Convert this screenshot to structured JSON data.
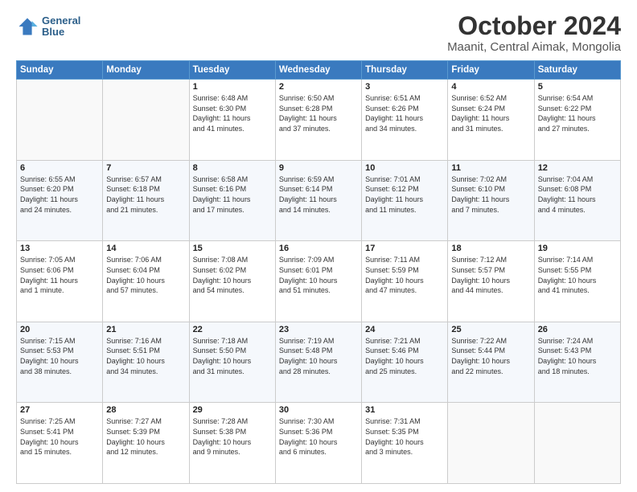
{
  "logo": {
    "line1": "General",
    "line2": "Blue"
  },
  "header": {
    "title": "October 2024",
    "subtitle": "Maanit, Central Aimak, Mongolia"
  },
  "days": [
    "Sunday",
    "Monday",
    "Tuesday",
    "Wednesday",
    "Thursday",
    "Friday",
    "Saturday"
  ],
  "weeks": [
    [
      {
        "num": "",
        "detail": ""
      },
      {
        "num": "",
        "detail": ""
      },
      {
        "num": "1",
        "detail": "Sunrise: 6:48 AM\nSunset: 6:30 PM\nDaylight: 11 hours\nand 41 minutes."
      },
      {
        "num": "2",
        "detail": "Sunrise: 6:50 AM\nSunset: 6:28 PM\nDaylight: 11 hours\nand 37 minutes."
      },
      {
        "num": "3",
        "detail": "Sunrise: 6:51 AM\nSunset: 6:26 PM\nDaylight: 11 hours\nand 34 minutes."
      },
      {
        "num": "4",
        "detail": "Sunrise: 6:52 AM\nSunset: 6:24 PM\nDaylight: 11 hours\nand 31 minutes."
      },
      {
        "num": "5",
        "detail": "Sunrise: 6:54 AM\nSunset: 6:22 PM\nDaylight: 11 hours\nand 27 minutes."
      }
    ],
    [
      {
        "num": "6",
        "detail": "Sunrise: 6:55 AM\nSunset: 6:20 PM\nDaylight: 11 hours\nand 24 minutes."
      },
      {
        "num": "7",
        "detail": "Sunrise: 6:57 AM\nSunset: 6:18 PM\nDaylight: 11 hours\nand 21 minutes."
      },
      {
        "num": "8",
        "detail": "Sunrise: 6:58 AM\nSunset: 6:16 PM\nDaylight: 11 hours\nand 17 minutes."
      },
      {
        "num": "9",
        "detail": "Sunrise: 6:59 AM\nSunset: 6:14 PM\nDaylight: 11 hours\nand 14 minutes."
      },
      {
        "num": "10",
        "detail": "Sunrise: 7:01 AM\nSunset: 6:12 PM\nDaylight: 11 hours\nand 11 minutes."
      },
      {
        "num": "11",
        "detail": "Sunrise: 7:02 AM\nSunset: 6:10 PM\nDaylight: 11 hours\nand 7 minutes."
      },
      {
        "num": "12",
        "detail": "Sunrise: 7:04 AM\nSunset: 6:08 PM\nDaylight: 11 hours\nand 4 minutes."
      }
    ],
    [
      {
        "num": "13",
        "detail": "Sunrise: 7:05 AM\nSunset: 6:06 PM\nDaylight: 11 hours\nand 1 minute."
      },
      {
        "num": "14",
        "detail": "Sunrise: 7:06 AM\nSunset: 6:04 PM\nDaylight: 10 hours\nand 57 minutes."
      },
      {
        "num": "15",
        "detail": "Sunrise: 7:08 AM\nSunset: 6:02 PM\nDaylight: 10 hours\nand 54 minutes."
      },
      {
        "num": "16",
        "detail": "Sunrise: 7:09 AM\nSunset: 6:01 PM\nDaylight: 10 hours\nand 51 minutes."
      },
      {
        "num": "17",
        "detail": "Sunrise: 7:11 AM\nSunset: 5:59 PM\nDaylight: 10 hours\nand 47 minutes."
      },
      {
        "num": "18",
        "detail": "Sunrise: 7:12 AM\nSunset: 5:57 PM\nDaylight: 10 hours\nand 44 minutes."
      },
      {
        "num": "19",
        "detail": "Sunrise: 7:14 AM\nSunset: 5:55 PM\nDaylight: 10 hours\nand 41 minutes."
      }
    ],
    [
      {
        "num": "20",
        "detail": "Sunrise: 7:15 AM\nSunset: 5:53 PM\nDaylight: 10 hours\nand 38 minutes."
      },
      {
        "num": "21",
        "detail": "Sunrise: 7:16 AM\nSunset: 5:51 PM\nDaylight: 10 hours\nand 34 minutes."
      },
      {
        "num": "22",
        "detail": "Sunrise: 7:18 AM\nSunset: 5:50 PM\nDaylight: 10 hours\nand 31 minutes."
      },
      {
        "num": "23",
        "detail": "Sunrise: 7:19 AM\nSunset: 5:48 PM\nDaylight: 10 hours\nand 28 minutes."
      },
      {
        "num": "24",
        "detail": "Sunrise: 7:21 AM\nSunset: 5:46 PM\nDaylight: 10 hours\nand 25 minutes."
      },
      {
        "num": "25",
        "detail": "Sunrise: 7:22 AM\nSunset: 5:44 PM\nDaylight: 10 hours\nand 22 minutes."
      },
      {
        "num": "26",
        "detail": "Sunrise: 7:24 AM\nSunset: 5:43 PM\nDaylight: 10 hours\nand 18 minutes."
      }
    ],
    [
      {
        "num": "27",
        "detail": "Sunrise: 7:25 AM\nSunset: 5:41 PM\nDaylight: 10 hours\nand 15 minutes."
      },
      {
        "num": "28",
        "detail": "Sunrise: 7:27 AM\nSunset: 5:39 PM\nDaylight: 10 hours\nand 12 minutes."
      },
      {
        "num": "29",
        "detail": "Sunrise: 7:28 AM\nSunset: 5:38 PM\nDaylight: 10 hours\nand 9 minutes."
      },
      {
        "num": "30",
        "detail": "Sunrise: 7:30 AM\nSunset: 5:36 PM\nDaylight: 10 hours\nand 6 minutes."
      },
      {
        "num": "31",
        "detail": "Sunrise: 7:31 AM\nSunset: 5:35 PM\nDaylight: 10 hours\nand 3 minutes."
      },
      {
        "num": "",
        "detail": ""
      },
      {
        "num": "",
        "detail": ""
      }
    ]
  ]
}
